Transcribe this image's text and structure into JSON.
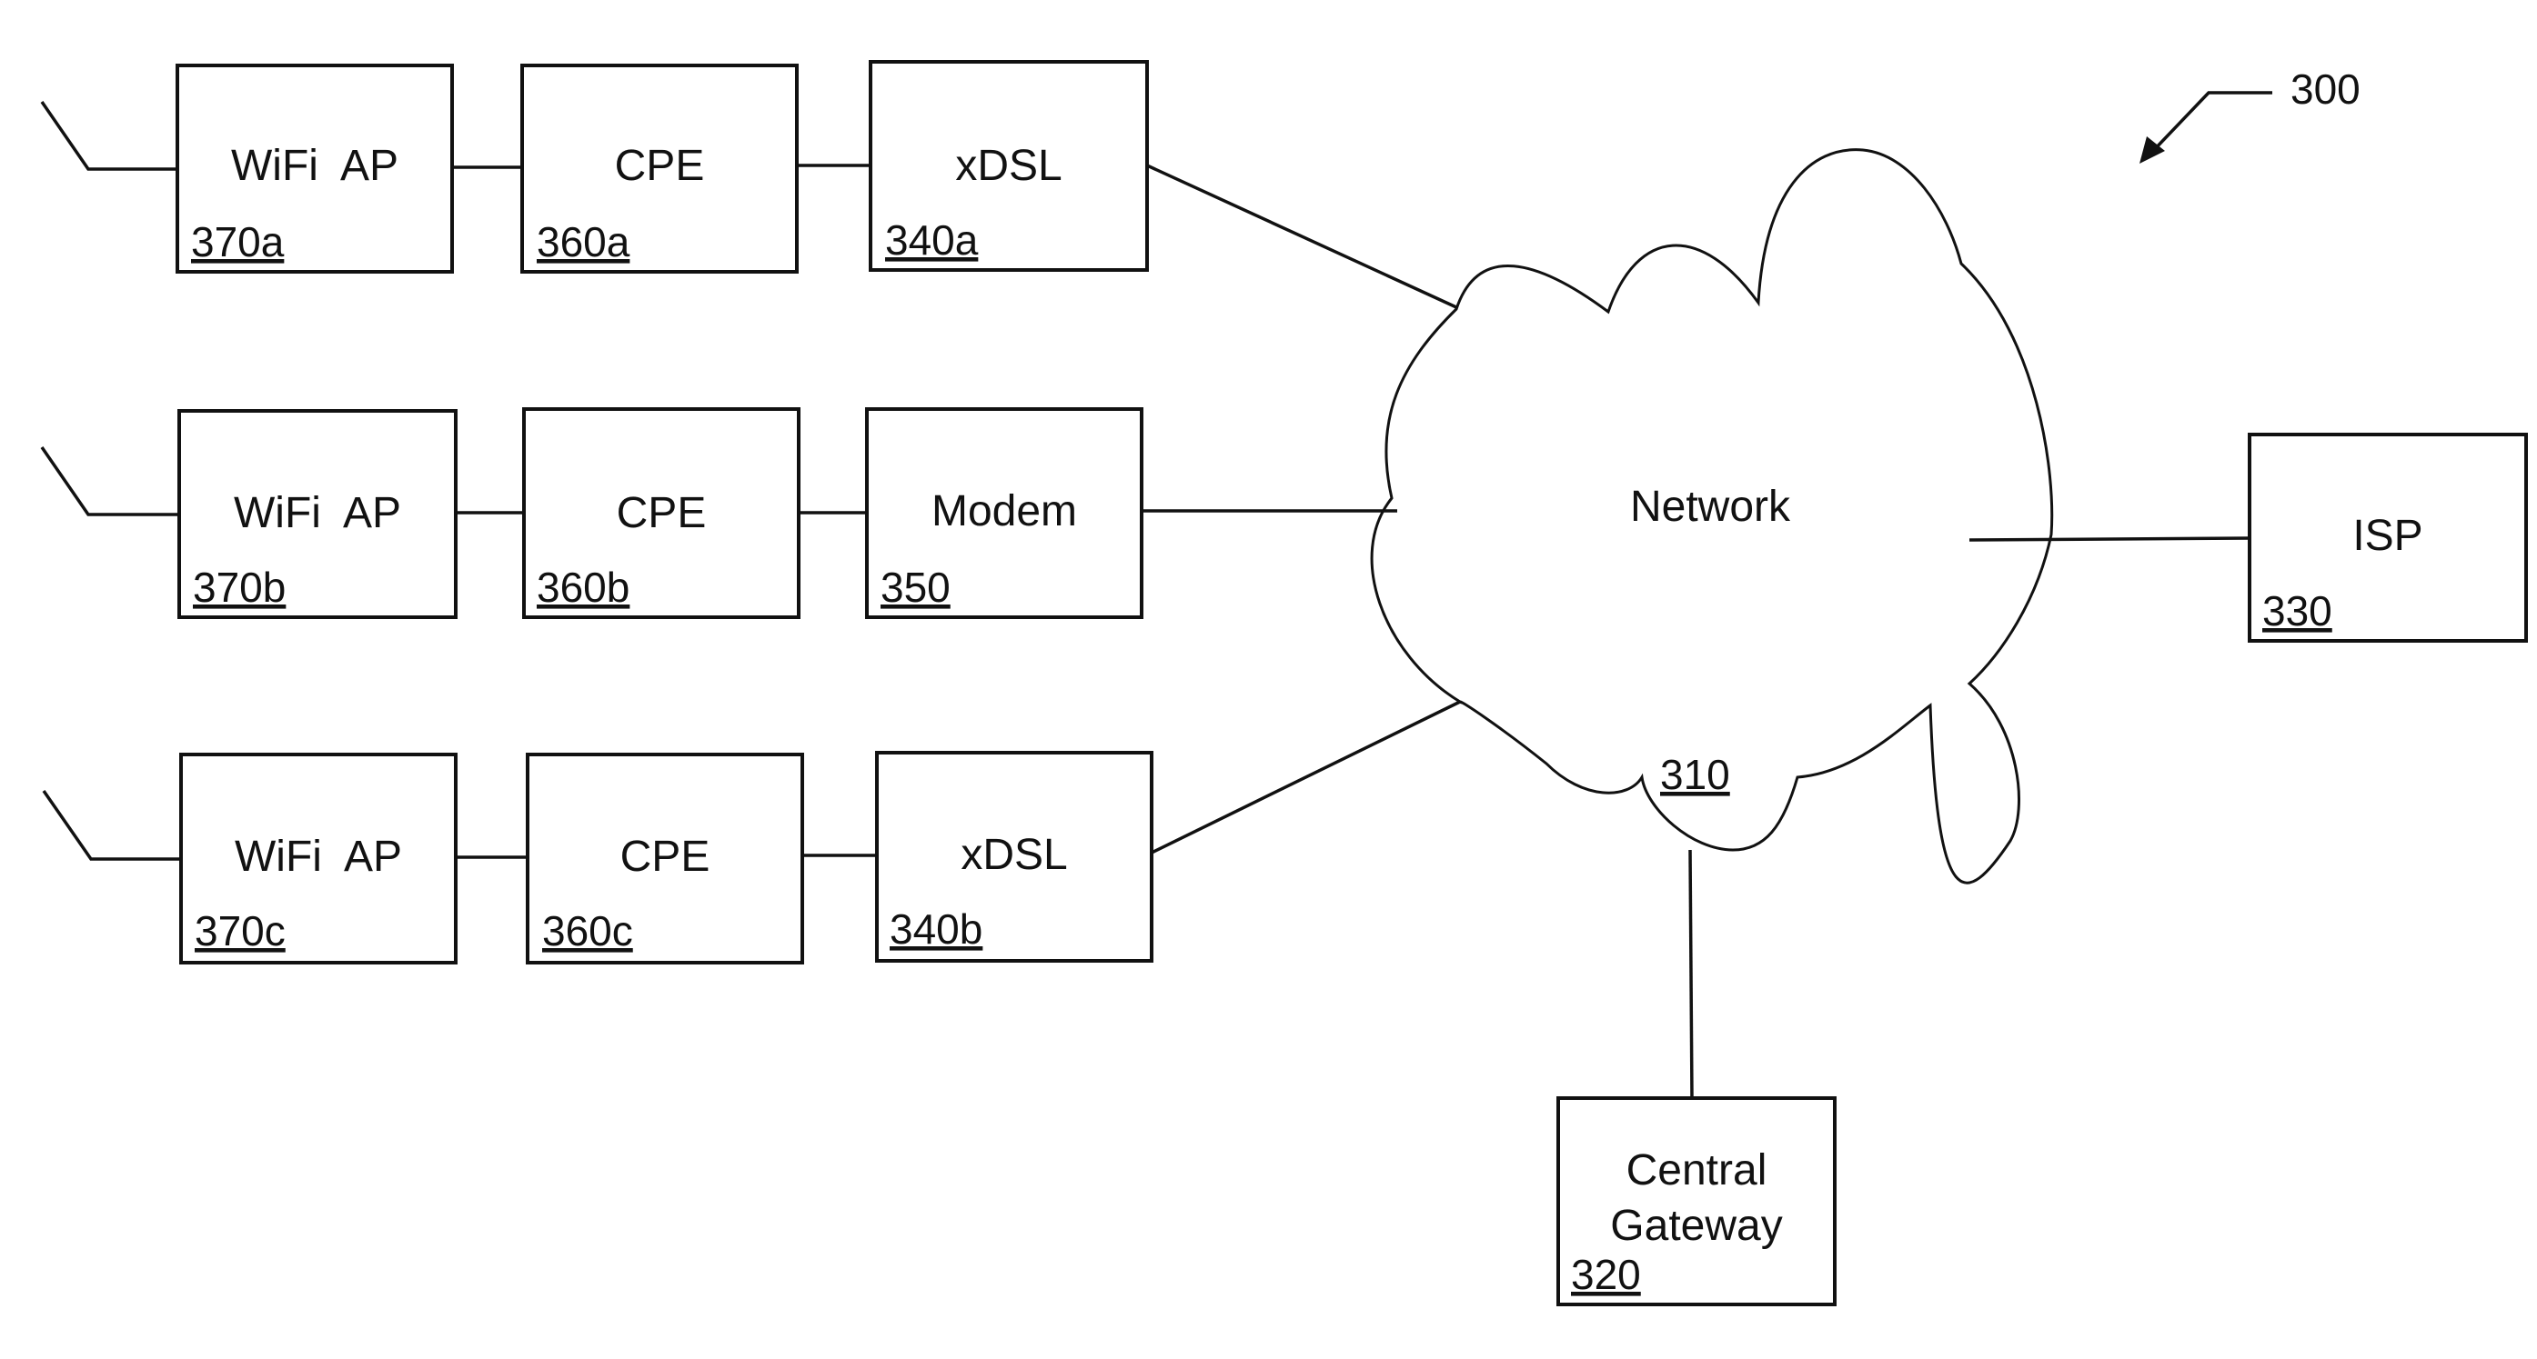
{
  "figure": {
    "ref": "300"
  },
  "network": {
    "label": "Network",
    "ref": "310"
  },
  "gateway": {
    "label_line1": "Central",
    "label_line2": "Gateway",
    "ref": "320"
  },
  "isp": {
    "label": "ISP",
    "ref": "330"
  },
  "rows": [
    {
      "wifi": {
        "label": "WiFi  AP",
        "ref": "370a"
      },
      "cpe": {
        "label": "CPE",
        "ref": "360a"
      },
      "link": {
        "label": "xDSL",
        "ref": "340a"
      }
    },
    {
      "wifi": {
        "label": "WiFi  AP",
        "ref": "370b"
      },
      "cpe": {
        "label": "CPE",
        "ref": "360b"
      },
      "link": {
        "label": "Modem",
        "ref": "350"
      }
    },
    {
      "wifi": {
        "label": "WiFi  AP",
        "ref": "370c"
      },
      "cpe": {
        "label": "CPE",
        "ref": "360c"
      },
      "link": {
        "label": "xDSL",
        "ref": "340b"
      }
    }
  ]
}
